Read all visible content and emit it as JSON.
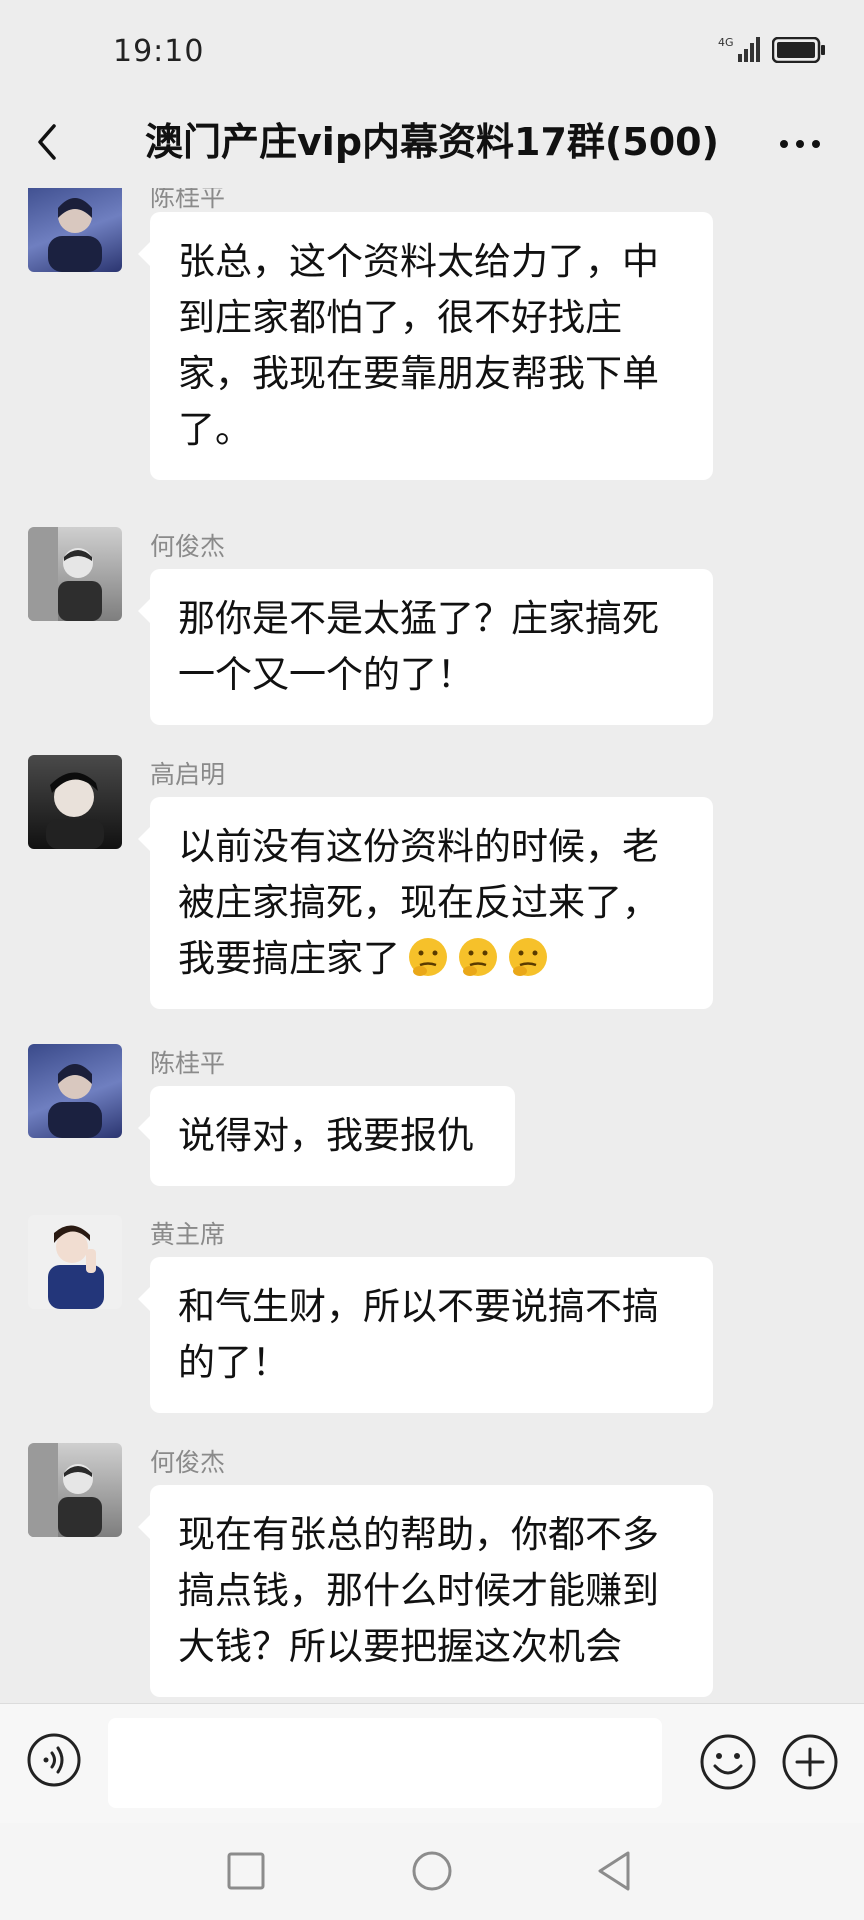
{
  "status_bar": {
    "time": "19:10",
    "network_label": "4G",
    "signal_icon": "signal-icon",
    "battery_icon": "battery-icon"
  },
  "header": {
    "title": "澳门产庄vip内幕资料17群(500)",
    "back_icon": "back-arrow-icon",
    "more_icon": "more-dots-icon"
  },
  "messages": [
    {
      "sender": "陈桂平",
      "text": "张总，这个资料太给力了，中到庄家都怕了，很不好找庄家，我现在要靠朋友帮我下单了。"
    },
    {
      "sender": "何俊杰",
      "text": "那你是不是太猛了？庄家搞死一个又一个的了！"
    },
    {
      "sender": "高启明",
      "text": "以前没有这份资料的时候，老被庄家搞死，现在反过来了，我要搞庄家了",
      "emoji": [
        "thinking-face-emoji",
        "thinking-face-emoji",
        "thinking-face-emoji"
      ]
    },
    {
      "sender": "陈桂平",
      "text": "说得对，我要报仇"
    },
    {
      "sender": "黄主席",
      "text": "和气生财，所以不要说搞不搞的了！"
    },
    {
      "sender": "何俊杰",
      "text": "现在有张总的帮助，你都不多搞点钱，那什么时候才能赚到大钱？所以要把握这次机会"
    }
  ],
  "input_bar": {
    "voice_icon": "voice-icon",
    "emoji_icon": "emoji-icon",
    "plus_icon": "plus-icon",
    "text_value": ""
  },
  "nav_bar": {
    "recents_icon": "square-icon",
    "home_icon": "circle-icon",
    "back_icon": "triangle-back-icon"
  }
}
